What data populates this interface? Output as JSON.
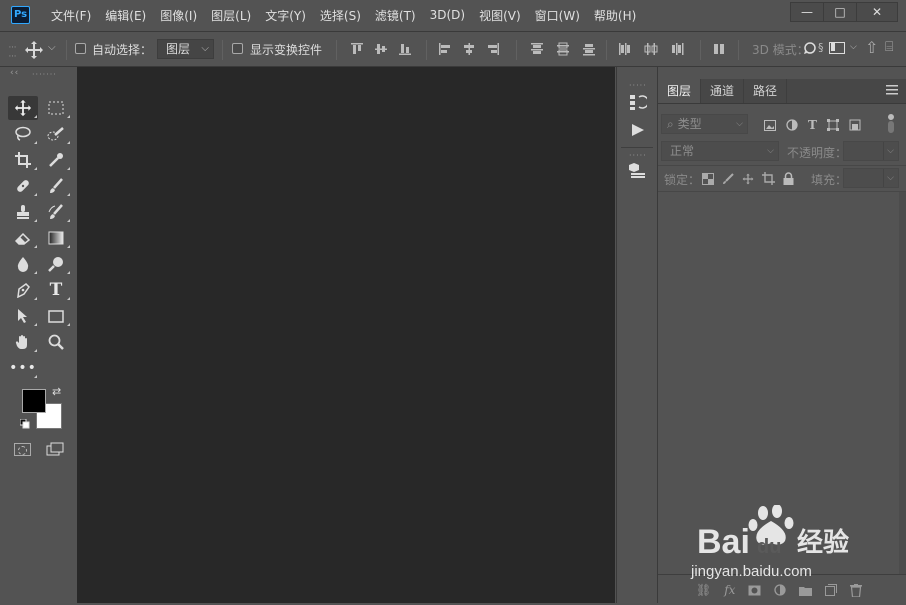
{
  "app": {
    "logo": "Ps"
  },
  "menu": [
    "文件(F)",
    "编辑(E)",
    "图像(I)",
    "图层(L)",
    "文字(Y)",
    "选择(S)",
    "滤镜(T)",
    "3D(D)",
    "视图(V)",
    "窗口(W)",
    "帮助(H)"
  ],
  "window_controls": {
    "minimize": "—",
    "maximize": "□",
    "close": "✕"
  },
  "options": {
    "auto_select_label": "自动选择：",
    "auto_select_value": "图层",
    "show_transform_label": "显示变换控件",
    "mode_3d_label": "3D 模式："
  },
  "panel": {
    "tabs": [
      "图层",
      "通道",
      "路径"
    ],
    "filter_kind": "类型",
    "blend_mode": "正常",
    "opacity_label": "不透明度：",
    "lock_label": "锁定：",
    "fill_label": "填充："
  },
  "watermark": {
    "brand": "Baidu 经验",
    "url": "jingyan.baidu.com"
  },
  "colors": {
    "foreground": "#000000",
    "background": "#ffffff",
    "canvas": "#282828",
    "ui": "#535353"
  }
}
